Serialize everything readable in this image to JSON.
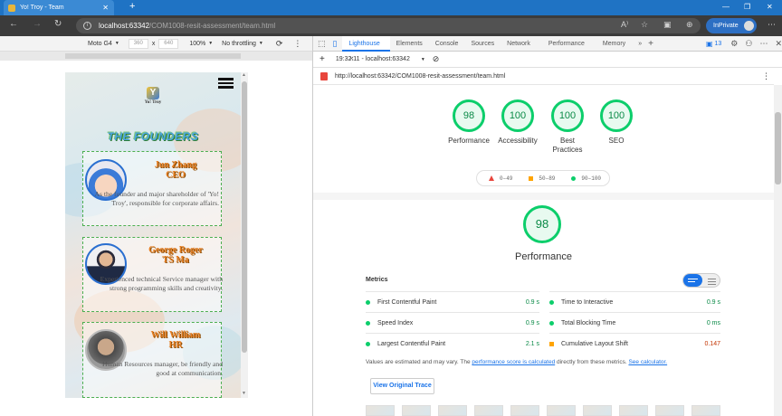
{
  "browser": {
    "tab_title": "Yo! Troy - Team",
    "url_host": "localhost:63342",
    "url_path": "/COM1008-resit-assessment/team.html",
    "inprivate_label": "InPrivate"
  },
  "device_toolbar": {
    "device": "Moto G4",
    "width": "360",
    "times": "x",
    "height": "640",
    "zoom": "100%",
    "throttle": "No throttling"
  },
  "page": {
    "brand": "Yo! Troy",
    "heading": "THE FOUNDERS",
    "founders": [
      {
        "name": "Jun Zhang",
        "role": "CEO",
        "desc": "As the founder and major shareholder of 'Yo! Troy', responsible for corporate affairs."
      },
      {
        "name": "George Roger",
        "role": "TS Ma",
        "desc": "Experienced technical Service manager with strong programming skills and creativity."
      },
      {
        "name": "Will William",
        "role": "HR",
        "desc": "Human Resources manager, be friendly and good at communication."
      }
    ]
  },
  "devtools": {
    "tabs": [
      "Lighthouse",
      "Elements",
      "Console",
      "Sources",
      "Network",
      "Performance",
      "Memory"
    ],
    "more": "»",
    "issues_count": "13",
    "report_time": "19:32:11 - localhost:63342",
    "report_url": "http://localhost:63342/COM1008-resit-assessment/team.html",
    "scores": [
      {
        "value": "98",
        "label": "Performance"
      },
      {
        "value": "100",
        "label": "Accessibility"
      },
      {
        "value": "100",
        "label": "Best Practices"
      },
      {
        "value": "100",
        "label": "SEO"
      }
    ],
    "legend": [
      "0–49",
      "50–89",
      "90–100"
    ],
    "perf_score": "98",
    "perf_title": "Performance",
    "metrics_title": "Metrics",
    "metrics_left": [
      {
        "name": "First Contentful Paint",
        "value": "0.9 s"
      },
      {
        "name": "Speed Index",
        "value": "0.9 s"
      },
      {
        "name": "Largest Contentful Paint",
        "value": "2.1 s"
      }
    ],
    "metrics_right": [
      {
        "name": "Time to Interactive",
        "value": "0.9 s"
      },
      {
        "name": "Total Blocking Time",
        "value": "0 ms"
      },
      {
        "name": "Cumulative Layout Shift",
        "value": "0.147"
      }
    ],
    "note_pre": "Values are estimated and may vary. The ",
    "note_link1": "performance score is calculated",
    "note_mid": " directly from these metrics. ",
    "note_link2": "See calculator.",
    "view_trace": "View Original Trace"
  }
}
